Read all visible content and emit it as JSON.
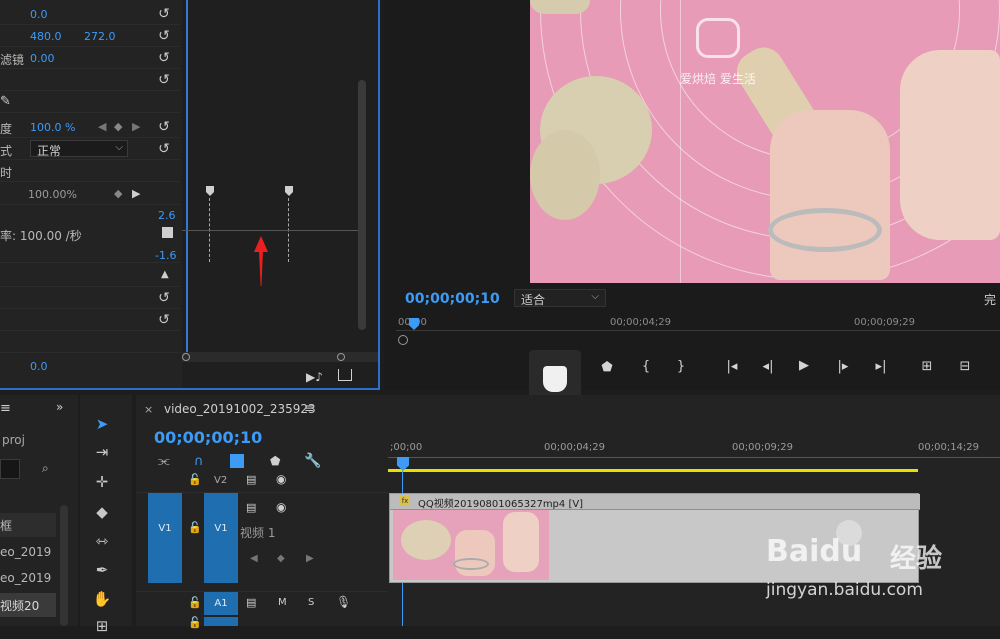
{
  "effect_controls": {
    "rows": [
      {
        "label": "",
        "v1": "0.0",
        "v2": ""
      },
      {
        "label": "",
        "v1": "480.0",
        "v2": "272.0"
      },
      {
        "label": "滤镜",
        "v1": "0.00",
        "v2": ""
      },
      {
        "label": "度",
        "v1": "100.0 %",
        "v2": ""
      },
      {
        "label": "式",
        "v1": "",
        "v2": ""
      },
      {
        "label": "时",
        "v1": "",
        "v2": ""
      },
      {
        "label": "",
        "v1": "100.00%",
        "v2": ""
      }
    ],
    "blend_mode": "正常",
    "speed_label": "率: 100.00 /秒",
    "graph_max": "2.6",
    "graph_min": "-1.6",
    "bottom_value": "0.0"
  },
  "program_monitor": {
    "timecode": "00;00;00;10",
    "fit": "适合",
    "quality": "完",
    "ruler": [
      "00;00",
      "00;00;04;29",
      "00;00;09;29"
    ],
    "watermark_sub": "爱烘焙 爱生活"
  },
  "project": {
    "file": "proj",
    "items": [
      "框",
      "eo_2019",
      "eo_2019",
      "视频20"
    ]
  },
  "timeline": {
    "sequence_name": "video_20191002_235923",
    "timecode": "00;00;00;10",
    "ruler": [
      ";00;00",
      "00;00;04;29",
      "00;00;09;29",
      "00;00;14;29"
    ],
    "tracks": {
      "v2": "V2",
      "v1": "V1",
      "v1_name": "视频 1",
      "a1": "A1",
      "mute": "M",
      "solo": "S"
    },
    "clip_label": "QQ视频20190801065327mp4 [V]",
    "clip_fx": "fx"
  },
  "watermark": {
    "brand": "Bai",
    "brand2": "du",
    "cn": "经验",
    "url": "jingyan.baidu.com"
  },
  "colors": {
    "accent": "#3d9bf5",
    "track_blue": "#1f6fb0",
    "work_area": "#e8e000",
    "clip": "#c8c8c8"
  }
}
